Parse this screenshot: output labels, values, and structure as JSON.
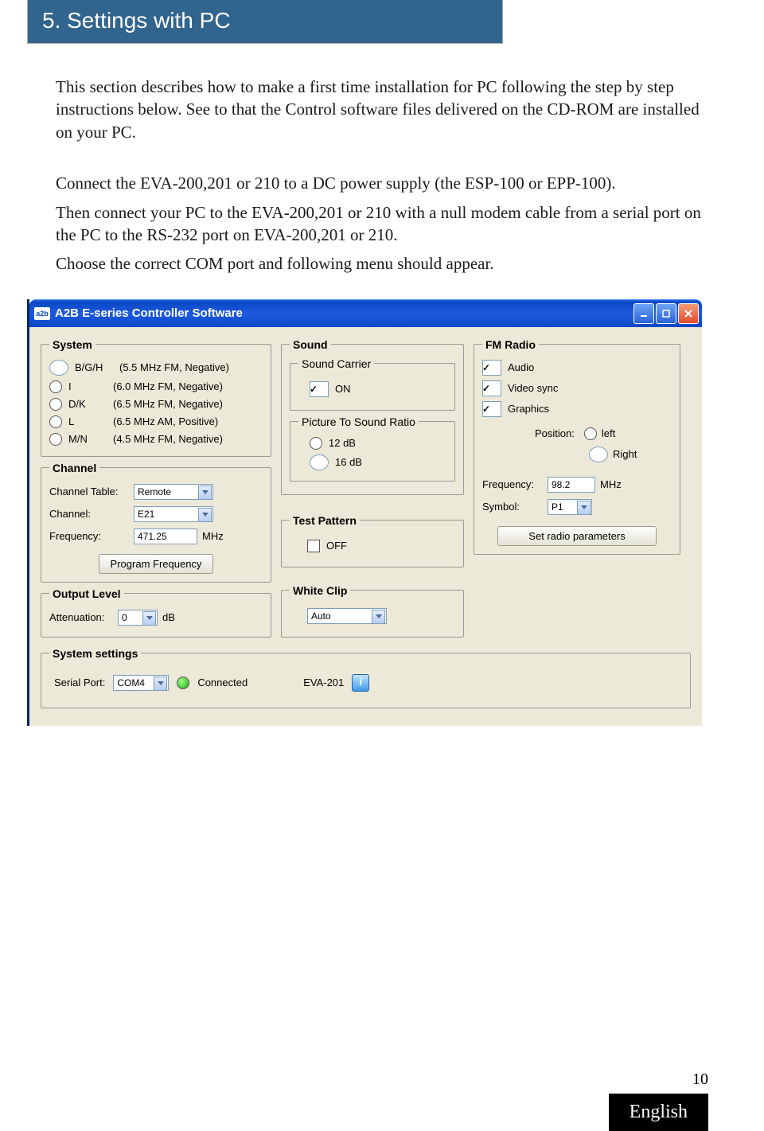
{
  "section_title": "5. Settings with PC",
  "paragraphs": {
    "p1": "This section describes how to make a first time installation for PC following the step by step instructions below. See to that the Control software files delivered on the CD-ROM are installed on your PC.",
    "p2": "Connect the EVA-200,201 or 210 to a DC power supply (the ESP-100 or EPP-100).",
    "p3": "Then connect your PC to the EVA-200,201 or 210 with a null modem cable from a serial port on the PC to the RS-232 port on EVA-200,201 or 210.",
    "p4": "Choose the correct COM port and following menu should appear."
  },
  "app": {
    "icon_text": "a2b",
    "title": "A2B E-series Controller Software"
  },
  "system": {
    "legend": "System",
    "options": [
      {
        "code": "B/G/H",
        "desc": "(5.5 MHz FM, Negative)",
        "selected": true
      },
      {
        "code": "I",
        "desc": "(6.0 MHz FM, Negative)",
        "selected": false
      },
      {
        "code": "D/K",
        "desc": "(6.5 MHz FM, Negative)",
        "selected": false
      },
      {
        "code": "L",
        "desc": "(6.5 MHz AM, Positive)",
        "selected": false
      },
      {
        "code": "M/N",
        "desc": "(4.5 MHz FM, Negative)",
        "selected": false
      }
    ]
  },
  "channel": {
    "legend": "Channel",
    "table_label": "Channel Table:",
    "table_value": "Remote",
    "channel_label": "Channel:",
    "channel_value": "E21",
    "freq_label": "Frequency:",
    "freq_value": "471.25",
    "freq_unit": "MHz",
    "button": "Program Frequency"
  },
  "output": {
    "legend": "Output Level",
    "att_label": "Attenuation:",
    "att_value": "0",
    "att_unit": "dB"
  },
  "syssettings": {
    "legend": "System settings",
    "port_label": "Serial Port:",
    "port_value": "COM4",
    "status": "Connected",
    "device": "EVA-201"
  },
  "sound": {
    "legend": "Sound",
    "carrier_legend": "Sound Carrier",
    "carrier_on": "ON",
    "ratio_legend": "Picture To Sound Ratio",
    "ratio_options": [
      {
        "label": "12 dB",
        "selected": false
      },
      {
        "label": "16 dB",
        "selected": true
      }
    ]
  },
  "testpattern": {
    "legend": "Test Pattern",
    "off": "OFF"
  },
  "whiteclip": {
    "legend": "White Clip",
    "value": "Auto"
  },
  "fmradio": {
    "legend": "FM Radio",
    "checks": [
      {
        "label": "Audio",
        "checked": true
      },
      {
        "label": "Video sync",
        "checked": true
      },
      {
        "label": "Graphics",
        "checked": true
      }
    ],
    "position_label": "Position:",
    "position_options": [
      {
        "label": "left",
        "selected": false
      },
      {
        "label": "Right",
        "selected": true
      }
    ],
    "freq_label": "Frequency:",
    "freq_value": "98.2",
    "freq_unit": "MHz",
    "symbol_label": "Symbol:",
    "symbol_value": "P1",
    "button": "Set radio parameters"
  },
  "page_number": "10",
  "language": "English"
}
